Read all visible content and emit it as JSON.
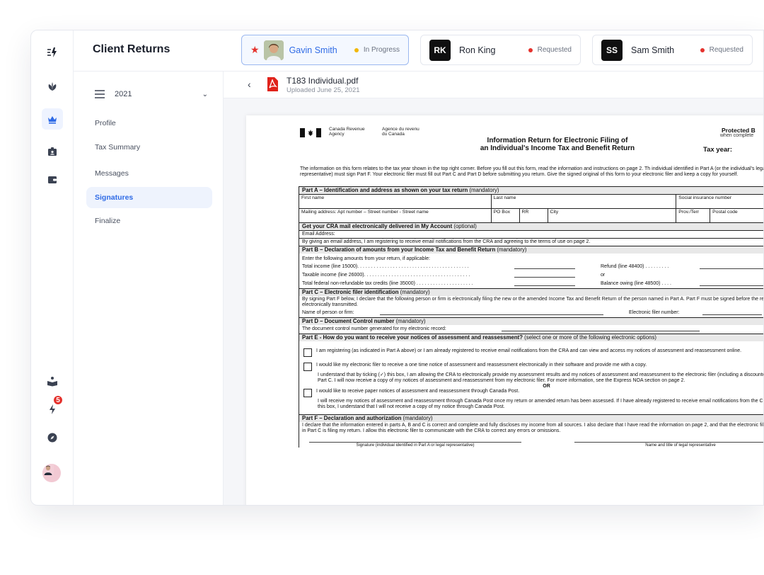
{
  "header": {
    "title": "Client Returns"
  },
  "client_tabs": [
    {
      "name": "Gavin Smith",
      "status": "In Progress",
      "status_color": "#f2b705",
      "starred": true,
      "active": true
    },
    {
      "name": "Ron King",
      "initials": "RK",
      "status": "Requested",
      "status_color": "#e5322d"
    },
    {
      "name": "Sam Smith",
      "initials": "SS",
      "status": "Requested",
      "status_color": "#e5322d"
    }
  ],
  "rail": {
    "icons": [
      "logo-icon",
      "leaf-icon",
      "crown-icon",
      "id-badge-icon",
      "wallet-icon",
      "reader-icon",
      "bolt-icon",
      "compass-icon"
    ],
    "notification_count": "5"
  },
  "sidebar": {
    "year": "2021",
    "items": [
      {
        "label": "Profile"
      },
      {
        "label": "Tax Summary"
      },
      {
        "label": "Messages"
      },
      {
        "label": "Signatures",
        "active": true
      },
      {
        "label": "Finalize"
      }
    ]
  },
  "file": {
    "name": "T183 Individual.pdf",
    "uploaded": "Uploaded June 25, 2021"
  },
  "document": {
    "agency_en": "Canada Revenue\nAgency",
    "agency_fr": "Agence du revenu\ndu Canada",
    "title": "Information Return for Electronic Filing of\nan Individual's Income Tax and Benefit Return",
    "protected": "Protected B",
    "protected_sub": "when complete",
    "tax_year": "Tax year:",
    "intro": "The information on this form relates to the tax year shown in the top right corner. Before you fill out this form, read the information and instructions on page 2. Th individual identified in Part A (or the individual's legal representative) must sign Part F. Your electronic filer must fill out Part C and Part D before submitting you return. Give the signed original of this form to your electronic filer and keep a copy for yourself.",
    "part_a": "Part A – Identification and address as shown on your tax return",
    "mandatory": "(mandatory)",
    "optional": "(optional)",
    "first_name": "First name",
    "last_name": "Last name",
    "sin": "Social insurance number",
    "mailing": "Mailing address: Apt number – Street number - Street name",
    "po_box": "PO Box",
    "rr": "RR",
    "city": "City",
    "prov": "Prov./Terr",
    "postal": "Postal code",
    "cra_mail": "Get your CRA mail electronically delivered in My Account",
    "email": "Email Address:",
    "email_note": "By giving an email address, I am registering to receive email notifications from the CRA and agreeing to the terms of use on page 2.",
    "part_b": "Part B – Declaration of amounts from your Income Tax and Benefit Return",
    "enter": "Enter the following amounts from your return, if applicable:",
    "total_income": "Total income (line 15000). . . . . . . . . . . . . . . . . . . . . . . . . . . . . . . . . . . . . . . . .",
    "refund": "Refund (line 48400) . . . . . . . . .",
    "taxable_income": "Taxable income (line 26000). . . . . . . . . . . . . . . . . . . . . . . . . . . . . . . . . . . . . . .",
    "or_small": "or",
    "credits": "Total federal non-refundable tax credits (line 35000) . . . . . . . . . . . . . . . . . . . . .",
    "balance": "Balance owing (line 48500) . . . .",
    "part_c": "Part C – Electronic filer identification",
    "part_c_text": "By signing Part F below, I declare that the following person or firm is electronically filing the new or the amended Income Tax and Benefit Return of the person named in Part A. Part F must be signed before the return is electronically transmitted.",
    "name_firm": "Name of person or firm:",
    "efile_no": "Electronic filer number:",
    "part_d": "Part D – Document Control number",
    "part_d_text": "The document control number generated for my electronic record:",
    "part_e": "Part E - How do you want to receive your notices of assessment and reassessment?",
    "part_e_sel": "(select one or more of the following electronic options)",
    "opt1": "I am registering (as indicated in Part A above) or I am already registered to receive email notifications from the CRA and can view and access my notices of assessment and reassessment online.",
    "opt2": "I would like my electronic filer to receive a one time notice of assessment and reassessment electronically in their software and provide me with a copy.",
    "opt2_sub": "I understand that by ticking (✓) this box, I am allowing the CRA to electronically provide my assessment results and my notices of assessment and reassessment to the electronic filer (including a discounter) named in Part C. I will now receive a copy of my notices of assessment and reassessment from my electronic filer. For more information, see the Express NOA section on page 2.",
    "or_big": "OR",
    "opt3": "I would like to receive paper notices of assessment and reassessment through Canada Post.",
    "opt3_sub": "I will receive my notices of assessment and reassessment through Canada Post once my return or amended return has been assessed. If I have already registered to receive email notifications from the CRA and I tick this box, I understand that I will not receive a copy of my notice through Canada Post.",
    "part_f": "Part F – Declaration and authorization",
    "part_f_text": "I declare that the information entered in parts A, B and C is correct and complete and fully discloses my income from all sources. I also declare that I have read the information on page 2, and that the electronic filer identified in Part C is filing my return. I allow this electronic filer to communicate with the CRA to correct any errors or omissions.",
    "sig_label": "Signature (individual identified in Part A or legal representative)",
    "name_title": "Name and title of legal representative"
  }
}
